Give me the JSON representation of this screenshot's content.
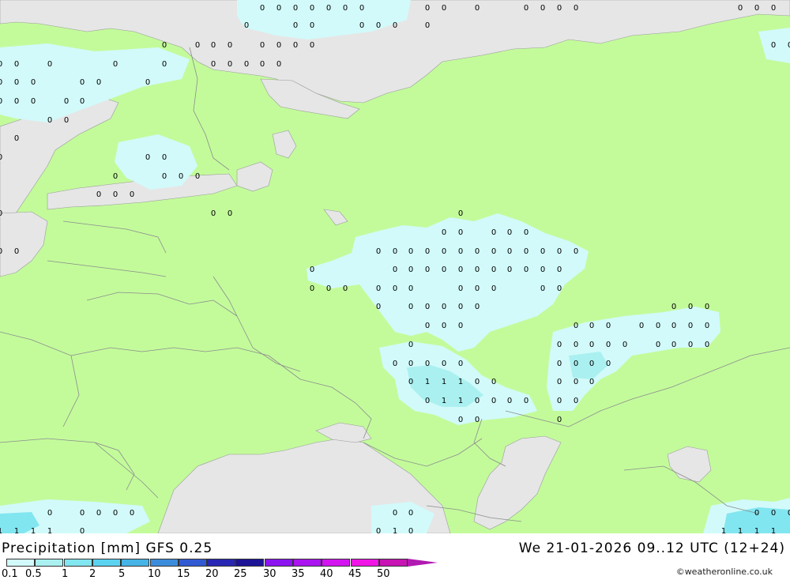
{
  "product": {
    "title_left": "Precipitation [mm] GFS 0.25",
    "title_right": "We 21-01-2026 09..12 UTC (12+24)",
    "credit": "©weatheronline.co.uk"
  },
  "legend": {
    "ticks": [
      "0.1",
      "0.5",
      "1",
      "2",
      "5",
      "10",
      "15",
      "20",
      "25",
      "30",
      "35",
      "40",
      "45",
      "50"
    ],
    "colors": [
      "#d2fafa",
      "#aaf0f0",
      "#82e6f0",
      "#5ad2f0",
      "#46b4e6",
      "#3c8cdc",
      "#325ad2",
      "#2828b4",
      "#1e1496",
      "#8c14f0",
      "#aa14f0",
      "#d214f0",
      "#f014e6",
      "#c814b4"
    ],
    "arrow_color": "#b01ab0"
  },
  "map_colors": {
    "land": "#c3fb9b",
    "water": "#e6e6e6",
    "precip_light": "#d2fafa",
    "precip_mid": "#aaf0f0",
    "precip_heavy": "#82e6f0",
    "border": "#8c8c8c"
  },
  "values": {
    "zero": "0",
    "one": "1"
  }
}
